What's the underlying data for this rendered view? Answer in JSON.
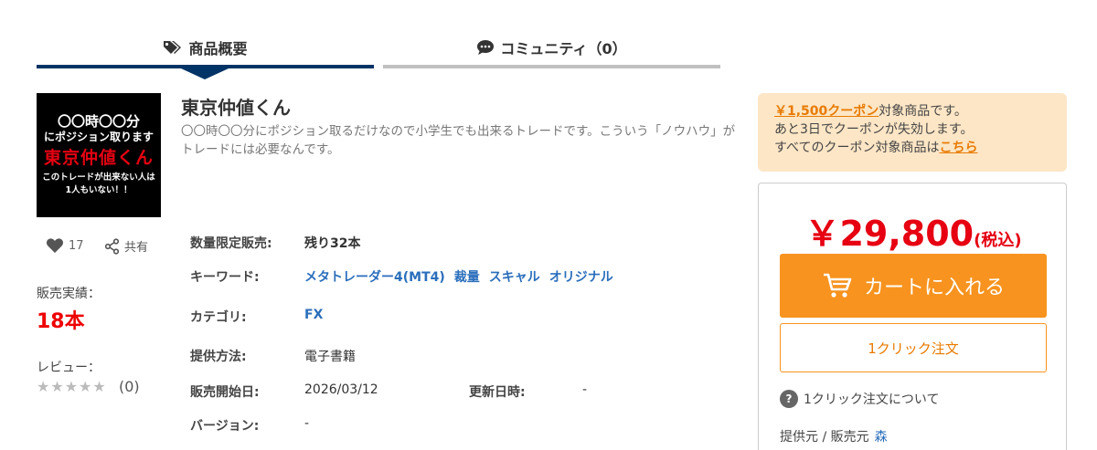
{
  "tabs": {
    "overview": "商品概要",
    "community": "コミュニティ（0）"
  },
  "product": {
    "thumb": {
      "line1": "〇〇時〇〇分",
      "line2": "にポジション取ります",
      "line3": "東京仲値くん",
      "line4": "このトレードが出来ない人は",
      "line5": "1人もいない！！"
    },
    "title": "東京仲値くん",
    "description": "〇〇時〇〇分にポジション取るだけなので小学生でも出来るトレードです。こういう「ノウハウ」がトレードには必要なんです。",
    "likes": "17",
    "share": "共有",
    "sales_label": "販売実績：",
    "sales_value": "18本",
    "review_label": "レビュー：",
    "review_stars": "★★★★★",
    "review_count": "(0)"
  },
  "info": {
    "limited_label": "数量限定販売:",
    "limited_value": "残り32本",
    "keyword_label": "キーワード:",
    "keywords": [
      "メタトレーダー4(MT4)",
      "裁量",
      "スキャル",
      "オリジナル"
    ],
    "category_label": "カテゴリ:",
    "category_value": "FX",
    "method_label": "提供方法:",
    "method_value": "電子書籍",
    "start_label": "販売開始日:",
    "start_value": "2026/03/12",
    "updated_label": "更新日時:",
    "updated_value": "-",
    "version_label": "バージョン:",
    "version_value": "-"
  },
  "coupon": {
    "amount": "￥1,500クーポン",
    "text1": "対象商品です。",
    "text2": "あと3日でクーポンが失効します。",
    "text3": "すべてのクーポン対象商品は",
    "link": "こちら"
  },
  "purchase": {
    "price": "￥29,800",
    "tax": "(税込)",
    "cart_label": "カートに入れる",
    "oneclick_label": "1クリック注文",
    "help_label": "1クリック注文について",
    "seller_label": "提供元 / 販売元",
    "seller_name": "森"
  },
  "colors": {
    "accent": "#f7931e",
    "navy": "#003366",
    "price_red": "#e60012",
    "link": "#2a6ebb"
  }
}
